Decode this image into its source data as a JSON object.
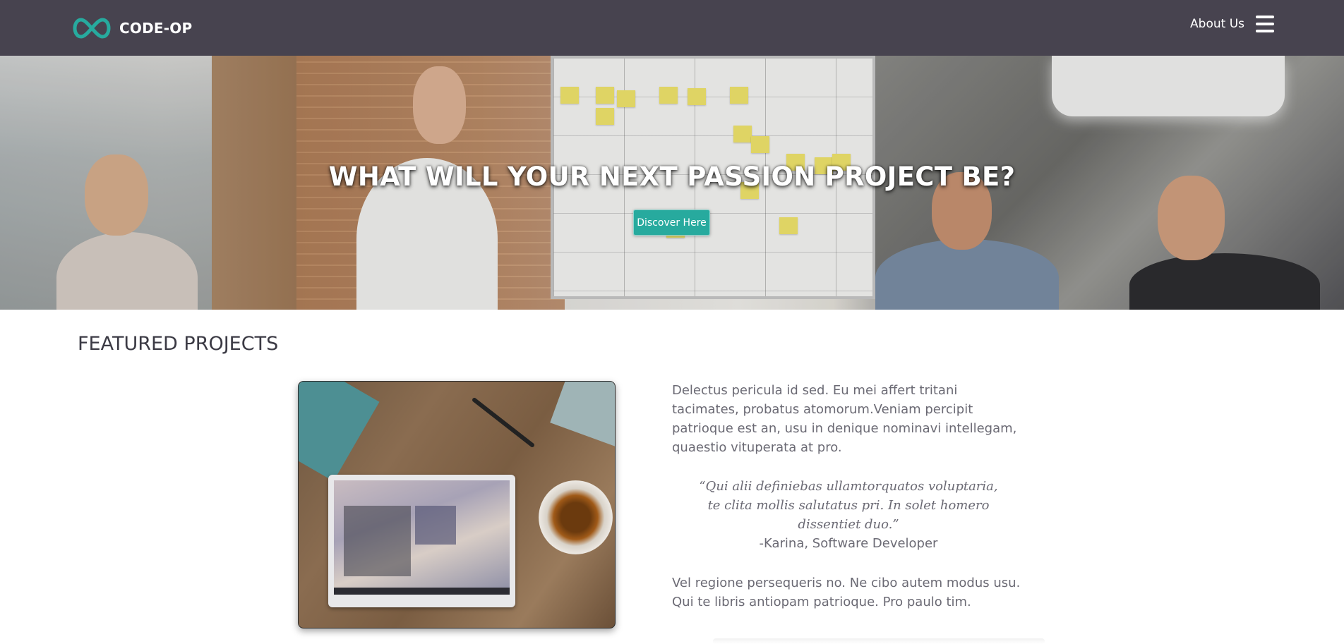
{
  "navbar": {
    "brand_name": "CODE-OP",
    "logo_icon": "infinity-icon",
    "about_label": "About Us",
    "menu_icon": "hamburger-menu-icon",
    "background_color": "#47434f",
    "accent_color": "#27aa9e"
  },
  "hero": {
    "title": "WHAT WILL YOUR NEXT PASSION PROJECT BE?",
    "button_label": "Discover Here",
    "button_color": "#27aa9e"
  },
  "featured": {
    "section_title": "FEATURED PROJECTS",
    "description": "Delectus pericula id sed. Eu mei affert tritani tacimates, probatus atomorum.Veniam percipit patrioque est an, usu in denique nominavi intellegam, quaestio vituperata at pro.",
    "quote": "“Qui alii definiebas ullamtorquatos voluptaria, te clita mollis salutatus pri. In solet homero dissentiet duo.”",
    "attribution": "-Karina, Software Developer",
    "description2": "Vel regione persequeris no. Ne cibo autem modus usu. Qui te libris antiopam patrioque. Pro paulo tim."
  }
}
